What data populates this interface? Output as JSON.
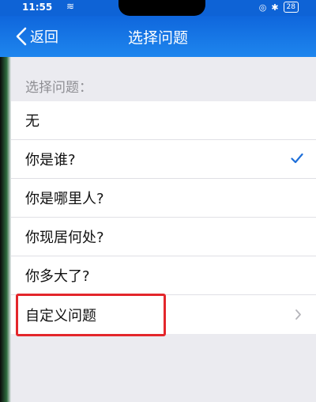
{
  "status_bar": {
    "time": "11:55",
    "battery": "28"
  },
  "nav": {
    "back_label": "返回",
    "title": "选择问题"
  },
  "section_header": "选择问题：",
  "items": [
    {
      "label": "无",
      "selected": false,
      "has_chevron": false
    },
    {
      "label": "你是谁?",
      "selected": true,
      "has_chevron": false
    },
    {
      "label": "你是哪里人?",
      "selected": false,
      "has_chevron": false
    },
    {
      "label": "你现居何处?",
      "selected": false,
      "has_chevron": false
    },
    {
      "label": "你多大了?",
      "selected": false,
      "has_chevron": false
    },
    {
      "label": "自定义问题",
      "selected": false,
      "has_chevron": true
    }
  ],
  "colors": {
    "nav_blue": "#1e86ee",
    "check_blue": "#1e6fd9",
    "highlight_red": "#e3262b"
  }
}
